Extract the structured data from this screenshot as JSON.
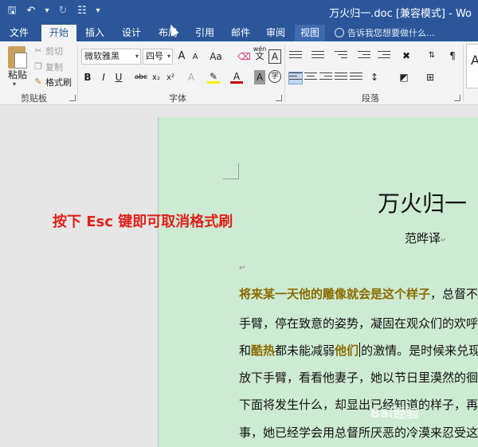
{
  "titlebar": {
    "document_title": "万火归一.doc [兼容模式] - Wo",
    "qat": [
      "save-icon",
      "undo-icon",
      "redo-icon",
      "tree-icon",
      "customize-icon"
    ]
  },
  "tabs": [
    {
      "label": "文件"
    },
    {
      "label": "开始"
    },
    {
      "label": "插入"
    },
    {
      "label": "设计"
    },
    {
      "label": "布局"
    },
    {
      "label": "引用"
    },
    {
      "label": "邮件"
    },
    {
      "label": "审阅"
    },
    {
      "label": "视图"
    }
  ],
  "tell_me": "告诉我您想要做什么...",
  "clipboard": {
    "paste": "粘贴",
    "cut": "剪切",
    "copy": "复制",
    "format_painter": "格式刷",
    "group_label": "剪贴板"
  },
  "font": {
    "font_name": "微软雅黑",
    "font_size": "四号",
    "grow": "A",
    "shrink": "A",
    "change_case": "Aa",
    "wen": "wén",
    "wen_char": "文",
    "border_char": "A",
    "bold": "B",
    "italic": "I",
    "underline": "U",
    "strike": "abc",
    "subscript": "x₂",
    "superscript": "x²",
    "effects": "A",
    "color": "A",
    "shade": "A",
    "enclose": "字",
    "group_label": "字体"
  },
  "paragraph": {
    "group_label": "段落"
  },
  "styles": {
    "preview": "A"
  },
  "document": {
    "heading": "万火归一",
    "author": "范晔译",
    "lines": [
      {
        "parts": [
          {
            "t": "将来某一天他的雕像就会是这个样子",
            "hl": true
          },
          {
            "t": "，总督不",
            "hl": false
          }
        ]
      },
      {
        "parts": [
          {
            "t": "手臂，停在致意的姿势，凝固在观众们的欢呼",
            "hl": false
          }
        ]
      },
      {
        "parts": [
          {
            "t": "和",
            "hl": false
          },
          {
            "t": "酷热",
            "hl": true
          },
          {
            "t": "都未能减弱",
            "hl": false
          },
          {
            "t": "他们",
            "hl": true
          },
          {
            "t": "的激情。是时候来兑现",
            "hl": false
          }
        ]
      },
      {
        "parts": [
          {
            "t": "放下手臂，看看他妻子，她以节日里漠然的徊",
            "hl": false
          }
        ]
      },
      {
        "parts": [
          {
            "t": "下面将发生什么，却显出已经知道的样子，再",
            "hl": false
          }
        ]
      },
      {
        "parts": [
          {
            "t": "事，她已经学会用总督所厌恶的冷漠来忍受这",
            "hl": false
          }
        ]
      }
    ]
  },
  "annotation": "按下 Esc 键即可取消格式刷",
  "watermark": "Bai经验",
  "colors": {
    "title_bar": "#2b579a",
    "page_bg": "#cdebd3",
    "highlight_text": "#8a6b00",
    "annotation": "#e0201a"
  }
}
